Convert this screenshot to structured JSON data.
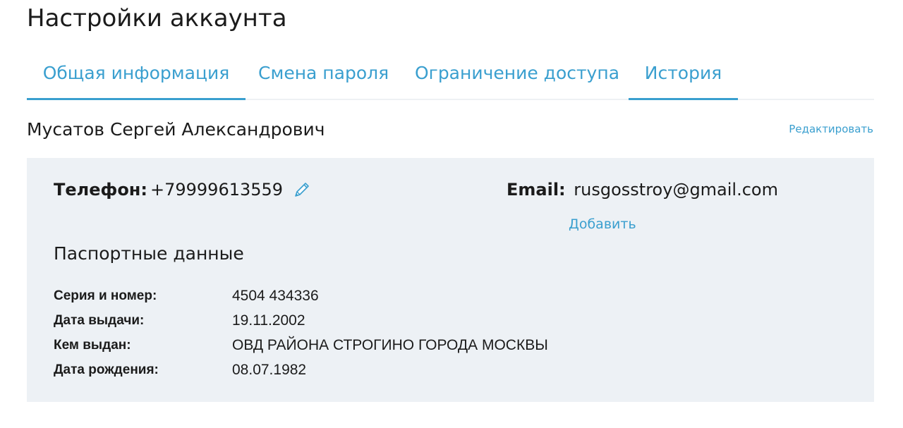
{
  "header": {
    "title": "Настройки аккаунта"
  },
  "tabs": [
    {
      "label": "Общая информация",
      "active": true
    },
    {
      "label": "Смена пароля",
      "active": false
    },
    {
      "label": "Ограничение доступа",
      "active": false
    },
    {
      "label": "История",
      "active": true
    }
  ],
  "profile": {
    "full_name": "Мусатов Сергей Александрович",
    "edit_label": "Редактировать"
  },
  "contacts": {
    "phone_label": "Телефон:",
    "phone_value": "+79999613559",
    "email_label": "Email:",
    "email_value": "rusgosstroy@gmail.com",
    "add_label": "Добавить"
  },
  "passport": {
    "title": "Паспортные данные",
    "rows": [
      {
        "label": "Серия и номер:",
        "value": "4504 434336"
      },
      {
        "label": "Дата выдачи:",
        "value": "19.11.2002"
      },
      {
        "label": "Кем выдан:",
        "value": "ОВД РАЙОНА СТРОГИНО ГОРОДА МОСКВЫ"
      },
      {
        "label": "Дата рождения:",
        "value": "08.07.1982"
      }
    ]
  },
  "icons": {
    "edit_phone": "pencil-icon"
  },
  "colors": {
    "accent": "#3a9fcf",
    "card_background": "#edf1f5",
    "text": "#1b1b1b"
  }
}
